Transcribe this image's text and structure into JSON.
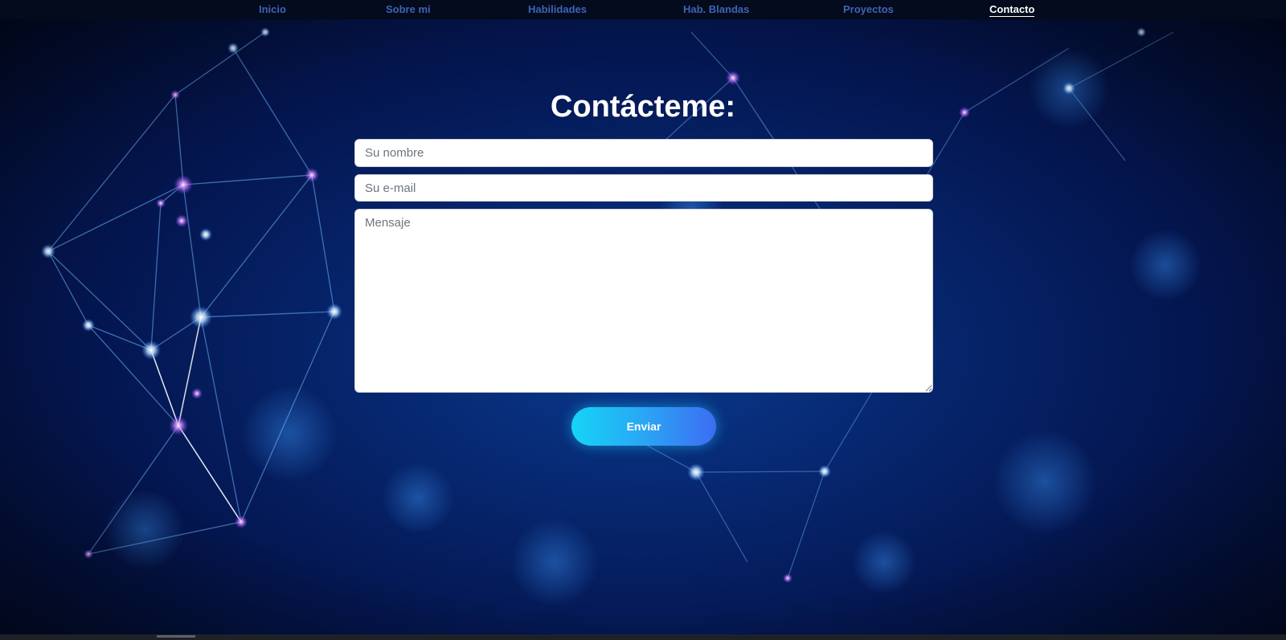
{
  "nav": {
    "items": [
      {
        "label": "Inicio"
      },
      {
        "label": "Sobre mi"
      },
      {
        "label": "Habilidades"
      },
      {
        "label": "Hab. Blandas"
      },
      {
        "label": "Proyectos"
      },
      {
        "label": "Contacto",
        "active": true
      }
    ]
  },
  "contact": {
    "title": "Contácteme:",
    "name_placeholder": "Su nombre",
    "email_placeholder": "Su e-mail",
    "message_placeholder": "Mensaje",
    "send_label": "Enviar"
  },
  "theme": {
    "background": "#06246a",
    "nav_background": "#030b1c",
    "nav_link": "#3f63b8",
    "nav_active": "#ffffff",
    "button_gradient_start": "#16d4f7",
    "button_gradient_end": "#3d6cf2"
  },
  "icons": {
    "background": "network-constellation-image"
  }
}
